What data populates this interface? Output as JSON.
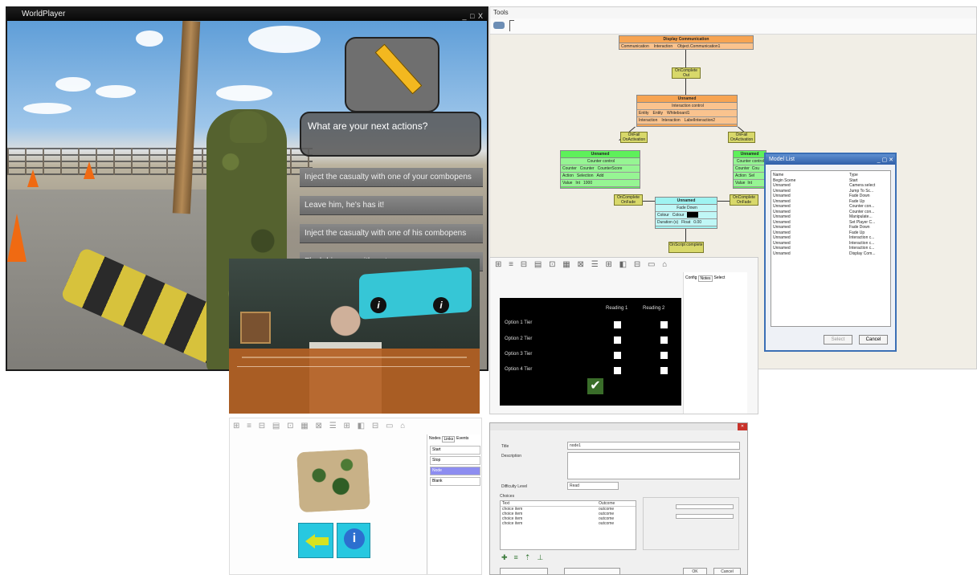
{
  "world_player": {
    "title": "WorldPlayer",
    "window_controls": "_ □ X",
    "question": "What are your next actions?",
    "options": [
      "Inject the casualty with one of your combopens",
      "Leave him, he's has it!",
      "Inject the casualty with one of his combopens",
      "Flush his eyes with water"
    ]
  },
  "tools": {
    "title": "Tools",
    "nodes": {
      "root": {
        "header": "Display Communication",
        "k": "Communication",
        "t": "Interaction",
        "v": "Object.Communication1"
      },
      "interaction": {
        "header": "Unnamed",
        "sub": "Interaction control",
        "rows": [
          [
            "Entity",
            "Entity",
            "Whiteboard1"
          ],
          [
            "Interaction",
            "Interaction",
            "LabelInteraction2"
          ]
        ]
      },
      "counter_left": {
        "header": "Unnamed",
        "sub": "Counter control",
        "rows": [
          [
            "Counter",
            "Counter",
            "CounterScore"
          ],
          [
            "Action",
            "Selection",
            "Add"
          ],
          [
            "Value",
            "Int",
            "1000"
          ]
        ]
      },
      "counter_right": {
        "header": "Unnamed",
        "sub": "Counter control",
        "rows": [
          [
            "Counter",
            "Cou"
          ],
          [
            "Action",
            "Sel"
          ],
          [
            "Value",
            "Int"
          ]
        ]
      },
      "fade": {
        "header": "Unnamed",
        "sub": "Fade Down",
        "rows": [
          [
            "Colour",
            "Colour",
            ""
          ],
          [
            "Duration (s)",
            "Float",
            "0.00"
          ]
        ]
      }
    },
    "small_labels": [
      "OnComplete",
      "Out",
      "OnFail",
      "OnActivation",
      "OnComplete",
      "OnFade",
      "OnComplete",
      "OnFade",
      "OnFail",
      "OnActivation",
      "OnScript complete"
    ]
  },
  "model_list": {
    "title": "Model List",
    "headers": [
      "Name",
      "Type"
    ],
    "rows": [
      [
        "Begin Scene",
        "Start"
      ],
      [
        "Unnamed",
        "Camera select"
      ],
      [
        "Unnamed",
        "Jump To Sc..."
      ],
      [
        "Unnamed",
        "Fade Down"
      ],
      [
        "Unnamed",
        "Fade Up"
      ],
      [
        "Unnamed",
        "Counter con..."
      ],
      [
        "Unnamed",
        "Counter con..."
      ],
      [
        "Unnamed",
        "Manipulate..."
      ],
      [
        "Unnamed",
        "Set Player C..."
      ],
      [
        "Unnamed",
        "Fade Down"
      ],
      [
        "Unnamed",
        "Fade Up"
      ],
      [
        "Unnamed",
        "Interaction c..."
      ],
      [
        "Unnamed",
        "Interaction c..."
      ],
      [
        "Unnamed",
        "Interaction c..."
      ],
      [
        "Unnamed",
        "Display Com..."
      ]
    ],
    "select_label": "Select",
    "cancel_label": "Cancel"
  },
  "check_editor": {
    "headers": [
      "Reading 1",
      "Reading 2"
    ],
    "rows": [
      "Option 1 Tier",
      "Option 2 Tier",
      "Option 3 Tier",
      "Option 4 Tier"
    ],
    "side_tabs": [
      "Config",
      "Notes",
      "Select"
    ]
  },
  "map_editor": {
    "list_tabs": [
      "Nodes",
      "Links",
      "Events"
    ],
    "items": [
      "Start",
      "Stop",
      "Node",
      "Blank"
    ]
  },
  "props": {
    "title_label": "Title",
    "title_value": "node1",
    "description_label": "Description",
    "difficulty_label": "Difficulty Level",
    "difficulty_value": "Read",
    "choices_label": "Choices",
    "choice_headers": [
      "Text",
      "Outcome"
    ],
    "choices": [
      [
        "choice item",
        "outcome"
      ],
      [
        "choice item",
        "outcome"
      ],
      [
        "choice item",
        "outcome"
      ],
      [
        "choice item",
        "outcome"
      ]
    ],
    "ok_label": "OK",
    "cancel_label": "Cancel"
  },
  "colors": {
    "node_orange": "#f7a452",
    "node_green": "#5ef05a",
    "node_cyan": "#9ff3f1",
    "label_olive": "#d8d86a",
    "accent_blue": "#27c8e0"
  }
}
